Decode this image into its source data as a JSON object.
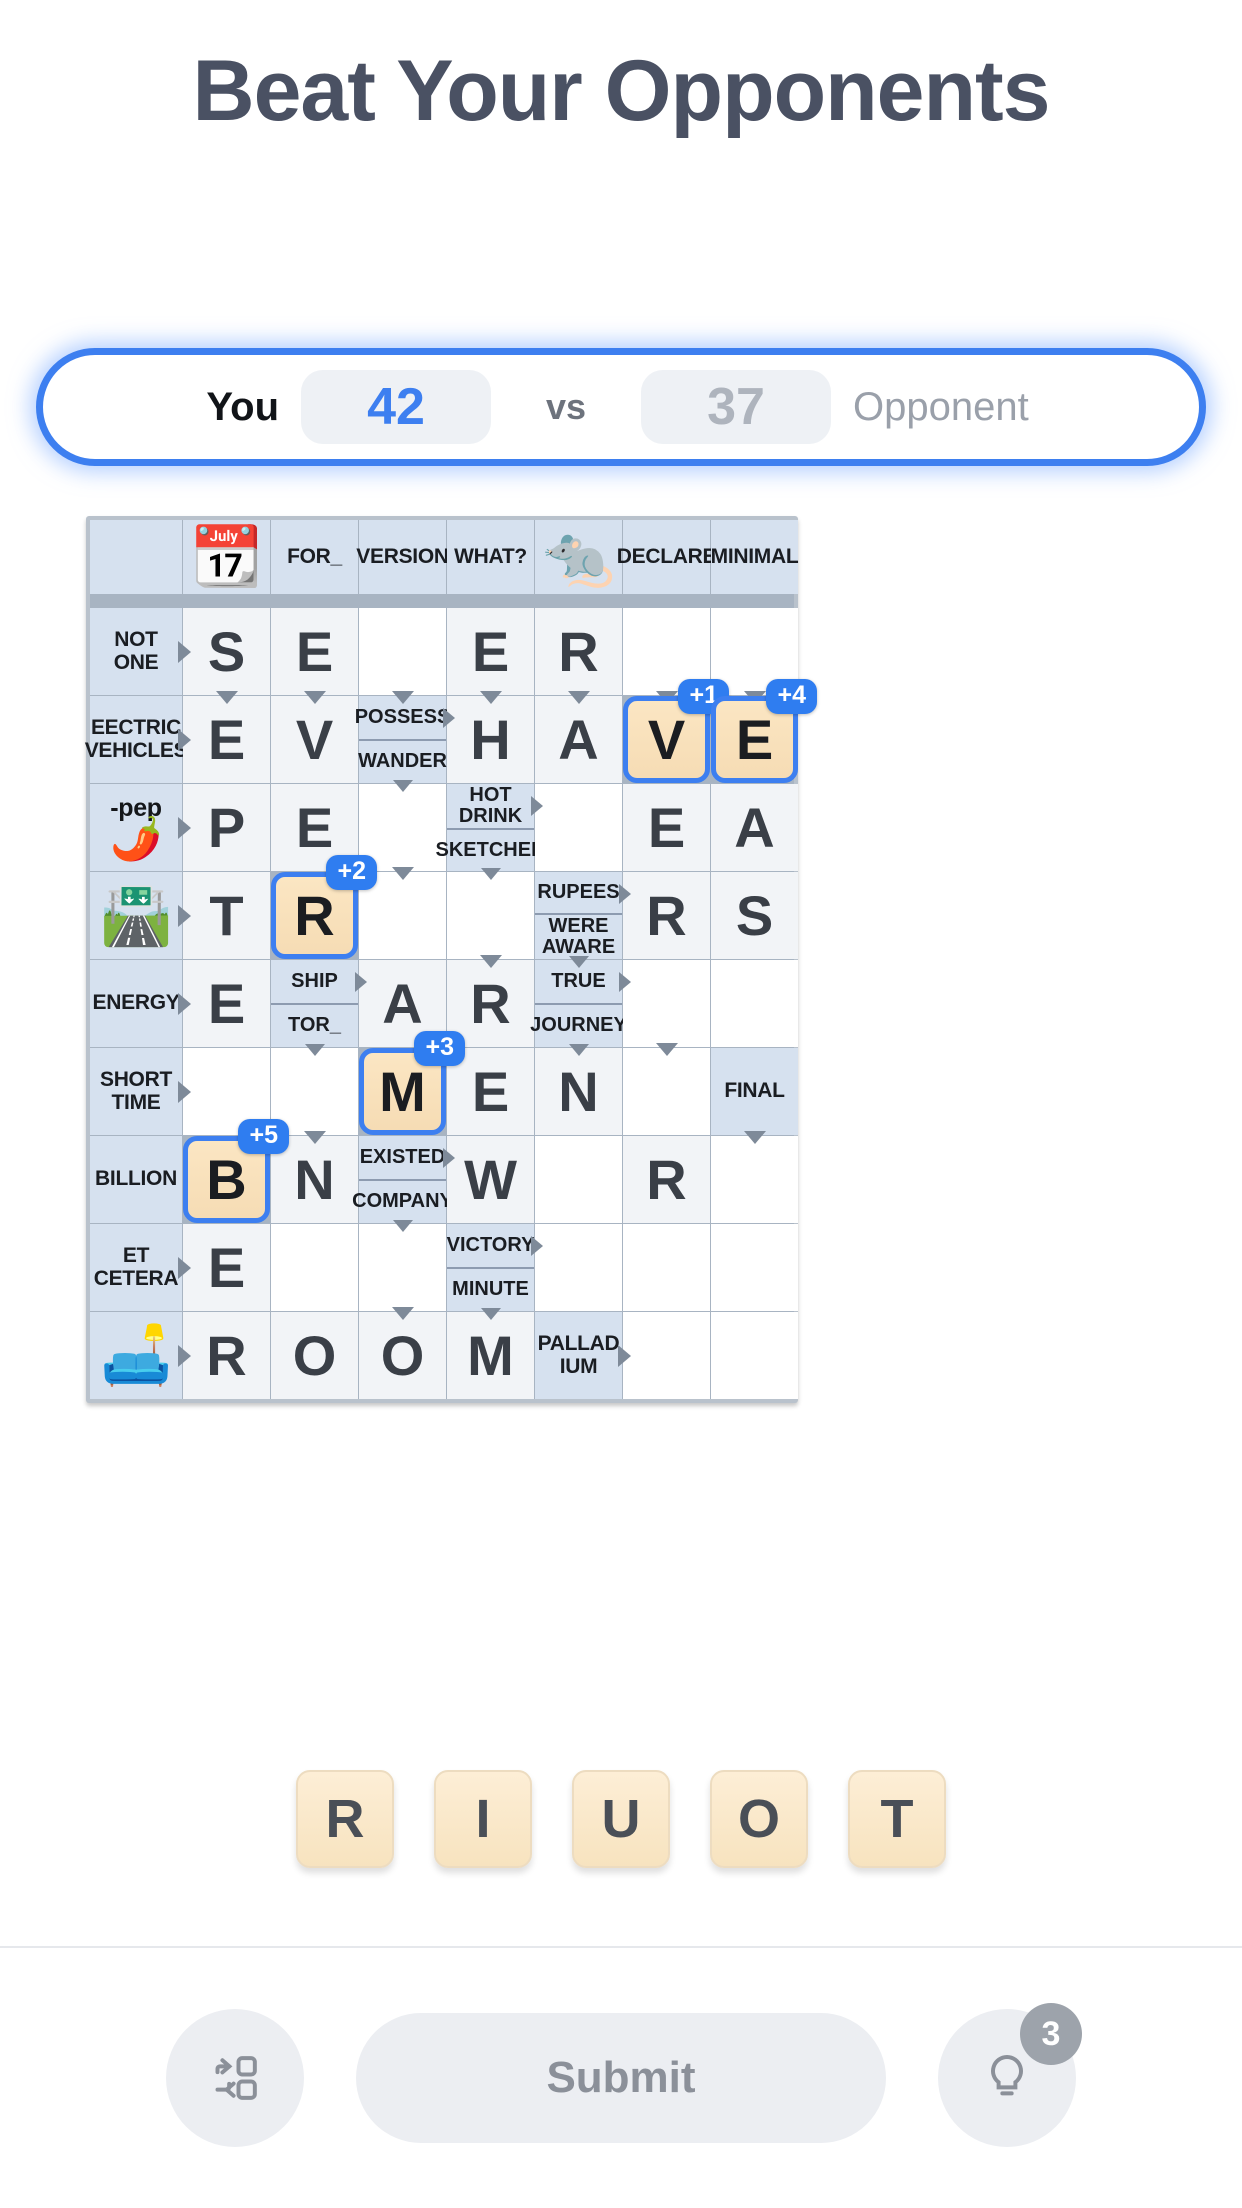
{
  "header": {
    "title": "Beat Your Opponents"
  },
  "scorebar": {
    "you_label": "You",
    "you_score": "42",
    "vs": "vs",
    "opponent_score": "37",
    "opponent_label": "Opponent",
    "accent_color": "#3d7ff0"
  },
  "grid": {
    "columns": 8,
    "rows": 10,
    "cells": [
      [
        {
          "t": "hdr"
        },
        {
          "t": "clue",
          "icon": "calendar-september-emoji",
          "v": "📆"
        },
        {
          "t": "clue",
          "v": "FOR_"
        },
        {
          "t": "clue",
          "v": "VERSION"
        },
        {
          "t": "clue",
          "v": "WHAT?"
        },
        {
          "t": "clue",
          "icon": "rat-emoji",
          "v": "🐀"
        },
        {
          "t": "clue",
          "v": "DECLARE"
        },
        {
          "t": "clue",
          "v": "MINIMAL"
        }
      ],
      [
        {
          "t": "clue",
          "v": "NOT ONE",
          "arrow": "right"
        },
        {
          "t": "letter",
          "v": "S",
          "arrow": "down"
        },
        {
          "t": "letter",
          "v": "E",
          "arrow": "down"
        },
        {
          "t": "blank",
          "arrow": "down"
        },
        {
          "t": "letter",
          "v": "E",
          "arrow": "down"
        },
        {
          "t": "letter",
          "v": "R",
          "arrow": "down"
        },
        {
          "t": "blank",
          "arrow": "down"
        },
        {
          "t": "blank",
          "arrow": "down"
        }
      ],
      [
        {
          "t": "clue",
          "v": "EECTRIC VEHICLES",
          "arrow": "right"
        },
        {
          "t": "letter",
          "v": "E"
        },
        {
          "t": "letter",
          "v": "V"
        },
        {
          "t": "split",
          "top": "POSSESS",
          "bottom": "WANDER",
          "arrow": "halfright"
        },
        {
          "t": "letter",
          "v": "H"
        },
        {
          "t": "letter",
          "v": "A"
        },
        {
          "t": "placed",
          "v": "V",
          "pts": "+1"
        },
        {
          "t": "placed",
          "v": "E",
          "pts": "+4"
        }
      ],
      [
        {
          "t": "clue",
          "icon": "chili-pepper-emoji",
          "pep": "-pep",
          "v": "🌶️",
          "arrow": "right"
        },
        {
          "t": "letter",
          "v": "P"
        },
        {
          "t": "letter",
          "v": "E"
        },
        {
          "t": "blank",
          "arrow": "down"
        },
        {
          "t": "split",
          "top": "HOT DRINK",
          "bottom": "SKETCHED",
          "arrow": "halfright"
        },
        {
          "t": "blank"
        },
        {
          "t": "letter",
          "v": "E"
        },
        {
          "t": "letter",
          "v": "A"
        }
      ],
      [
        {
          "t": "clue",
          "icon": "winding-road-emoji",
          "v": "🛣️",
          "arrow": "right"
        },
        {
          "t": "letter",
          "v": "T"
        },
        {
          "t": "placed",
          "v": "R",
          "pts": "+2"
        },
        {
          "t": "blank"
        },
        {
          "t": "blank",
          "arrow": "down"
        },
        {
          "t": "split",
          "top": "RUPEES",
          "bottom": "WERE AWARE",
          "arrow": "halfright"
        },
        {
          "t": "letter",
          "v": "R"
        },
        {
          "t": "letter",
          "v": "S"
        }
      ],
      [
        {
          "t": "clue",
          "v": "ENERGY",
          "arrow": "right"
        },
        {
          "t": "letter",
          "v": "E"
        },
        {
          "t": "split",
          "top": "SHIP",
          "bottom": "TOR_",
          "arrow": "halfright"
        },
        {
          "t": "letter",
          "v": "A"
        },
        {
          "t": "letter",
          "v": "R"
        },
        {
          "t": "split",
          "top": "TRUE",
          "bottom": "JOURNEY",
          "arrow": "halfright"
        },
        {
          "t": "blank",
          "arrow": "down"
        },
        {
          "t": "blank"
        }
      ],
      [
        {
          "t": "clue",
          "v": "SHORT TIME",
          "arrow": "right"
        },
        {
          "t": "blank"
        },
        {
          "t": "blank",
          "arrow": "down"
        },
        {
          "t": "placed",
          "v": "M",
          "pts": "+3"
        },
        {
          "t": "letter",
          "v": "E"
        },
        {
          "t": "letter",
          "v": "N"
        },
        {
          "t": "blank"
        },
        {
          "t": "clue",
          "v": "FINAL",
          "arrow": "down"
        }
      ],
      [
        {
          "t": "clue",
          "v": "BILLION"
        },
        {
          "t": "placed",
          "v": "B",
          "pts": "+5"
        },
        {
          "t": "letter",
          "v": "N"
        },
        {
          "t": "split",
          "top": "EXISTED",
          "bottom": "COMPANY",
          "arrow": "halfright"
        },
        {
          "t": "letter",
          "v": "W"
        },
        {
          "t": "blank"
        },
        {
          "t": "letter",
          "v": "R"
        },
        {
          "t": "blank"
        }
      ],
      [
        {
          "t": "clue",
          "v": "ET CETERA",
          "arrow": "right"
        },
        {
          "t": "letter",
          "v": "E"
        },
        {
          "t": "blank"
        },
        {
          "t": "blank",
          "arrow": "down"
        },
        {
          "t": "split",
          "top": "VICTORY",
          "bottom": "MINUTE",
          "arrow": "halfright"
        },
        {
          "t": "blank"
        },
        {
          "t": "blank"
        },
        {
          "t": "blank"
        }
      ],
      [
        {
          "t": "clue",
          "icon": "couch-lamp-emoji",
          "v": "🛋️",
          "arrow": "right"
        },
        {
          "t": "letter",
          "v": "R"
        },
        {
          "t": "letter",
          "v": "O"
        },
        {
          "t": "letter",
          "v": "O"
        },
        {
          "t": "letter",
          "v": "M"
        },
        {
          "t": "clue",
          "v": "PALLAD IUM",
          "arrow": "right"
        },
        {
          "t": "blank"
        },
        {
          "t": "blank"
        }
      ]
    ]
  },
  "tray": {
    "tiles": [
      "R",
      "I",
      "U",
      "O",
      "T"
    ]
  },
  "bottombar": {
    "shuffle_icon": "shuffle-icon",
    "submit_label": "Submit",
    "hint_icon": "lightbulb-icon",
    "hint_count": "3"
  }
}
